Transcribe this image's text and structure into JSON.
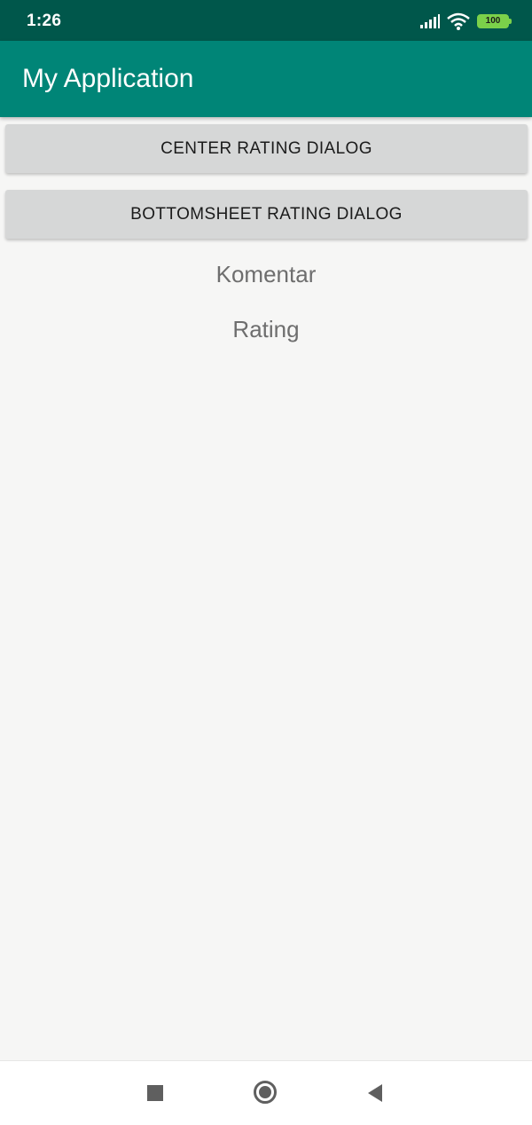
{
  "status_bar": {
    "time": "1:26",
    "battery_level": "100",
    "icons": [
      "signal-icon",
      "wifi-icon",
      "battery-icon"
    ],
    "battery_color": "#7bd14a"
  },
  "app_bar": {
    "title": "My Application",
    "color": "#008577"
  },
  "buttons": {
    "center_rating": "CENTER RATING DIALOG",
    "bottomsheet_rating": "BOTTOMSHEET RATING DIALOG"
  },
  "content": {
    "komentar": "Komentar",
    "rating": "Rating"
  },
  "nav_bar": {
    "icons": [
      "recents-square-icon",
      "home-circle-icon",
      "back-triangle-icon"
    ]
  }
}
